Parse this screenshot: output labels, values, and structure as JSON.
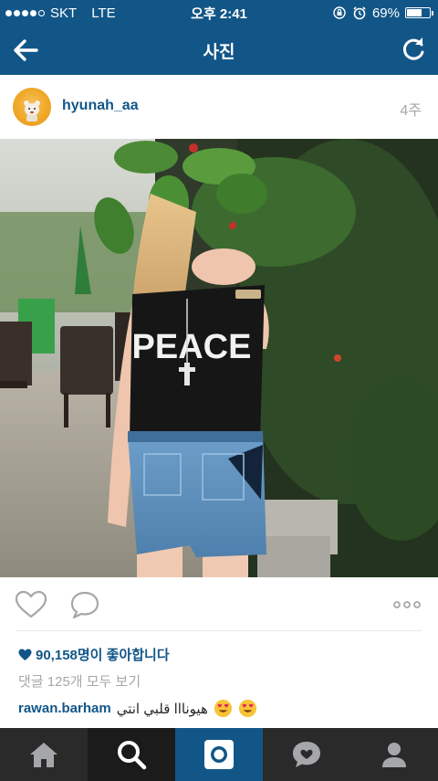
{
  "status_bar": {
    "carrier": "SKT",
    "network": "LTE",
    "time": "오후 2:41",
    "battery": "69%",
    "battery_level": 0.69,
    "icons": [
      "signal-dots-icon",
      "lock-rotation-icon",
      "alarm-icon",
      "battery-icon"
    ]
  },
  "nav": {
    "title": "사진",
    "icons": [
      "back-arrow-icon",
      "refresh-icon"
    ]
  },
  "post": {
    "username": "hyunah_aa",
    "time_ago": "4주",
    "likes": "90,158명이 좋아합니다",
    "view_comments": "댓글 125개 모두 보기",
    "comment": {
      "user": "rawan.barham",
      "text": "هيونااا قلبي انتي",
      "emojis": [
        "heart-eyes-emoji",
        "heart-eyes-emoji"
      ]
    },
    "photo_caption_on_shirt": "PEACE"
  },
  "actions": {
    "icons": [
      "heart-outline-icon",
      "comment-bubble-icon",
      "more-dots-icon"
    ]
  },
  "tabs": [
    {
      "name": "home-icon",
      "state": "inactive"
    },
    {
      "name": "search-icon",
      "state": "active"
    },
    {
      "name": "camera-icon",
      "state": "highlight"
    },
    {
      "name": "activity-heart-icon",
      "state": "inactive"
    },
    {
      "name": "profile-icon",
      "state": "inactive"
    }
  ],
  "colors": {
    "brand_blue": "#125688",
    "tabbar_dark": "#2a2a2a",
    "muted_text": "#a5a7aa"
  }
}
